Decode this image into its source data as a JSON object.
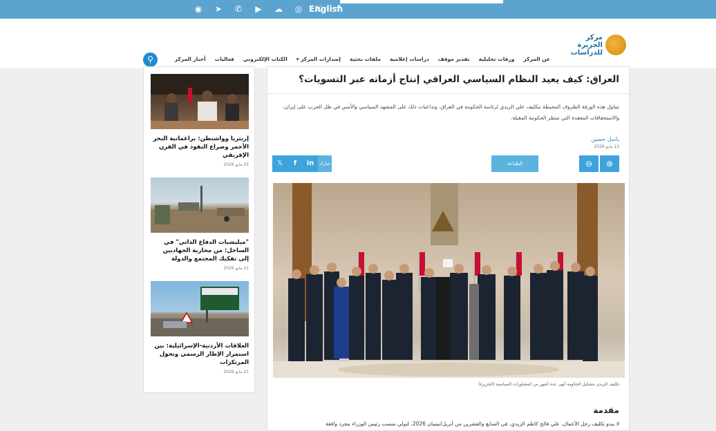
{
  "topbar": {
    "social_icons": [
      "rss-icon",
      "telegram-icon",
      "whatsapp-icon",
      "youtube-icon",
      "soundcloud-icon",
      "instagram-icon",
      "x-icon",
      "facebook-icon"
    ],
    "language_link": "English",
    "color": "#5ba4cf"
  },
  "header": {
    "logo_line1": "مركز الجزيرة",
    "logo_line2": "للدراسات",
    "nav": [
      "عن المركز",
      "ورقات تحليلية",
      "تقدير موقف",
      "دراسات إعلامية",
      "ملفات بحثية",
      "إصدارات المركز ▾",
      "الكتاب الإلكتروني",
      "فعاليات",
      "أخبار المركز"
    ]
  },
  "sidebar": {
    "cards": [
      {
        "title": "إريتريا وواشنطن: براغماتية البحر الأحمر وصراع النفوذ في القرن الإفريقي",
        "date": "25 مايو 2026"
      },
      {
        "title": "\"ميليشيات الدفاع الذاتي\" في الساحل: من محاربة الجهاديين إلى تفكيك المجتمع والدولة",
        "date": "21 مايو 2026"
      },
      {
        "title": "العلاقات الأردنية-الإسرائيلية: بين استمرار الإطار الرسمي وتحول المرتكزات",
        "date": "21 مايو 2026"
      }
    ]
  },
  "article": {
    "title": "العراق: كيف يعيد النظام السياسي العراقي إنتاج أزماته عبر التسويات؟",
    "lead": "تتناول هذه الورقة الظروف المحيطة بتكليف علي الزيدي لرئاسة الحكومة في العراق، وتداعيات ذلك على المشهد السياسي والأمني في ظل الحرب على إيران، والاستحقاقات المعقدة التي تنتظر الحكومة المقبلة.",
    "author": "باسل حسين",
    "date": "13 مايو 2026",
    "print_label": "الطباعة",
    "share_label": "شارك",
    "caption": "تكليف الزيدي بتشكيل الحكومة أنهى عدة أشهر من المشاورات السياسية (الجزيرة)",
    "section_heading": "مقدمة",
    "body_first_line": "لا يبدو تكليف رجل الأعمال، علي فالح كاظم الزيدي، في السابع والعشرين من أبريل/نيسان 2026، لتولي منصب رئيس الوزراء مجرد واقعة"
  }
}
